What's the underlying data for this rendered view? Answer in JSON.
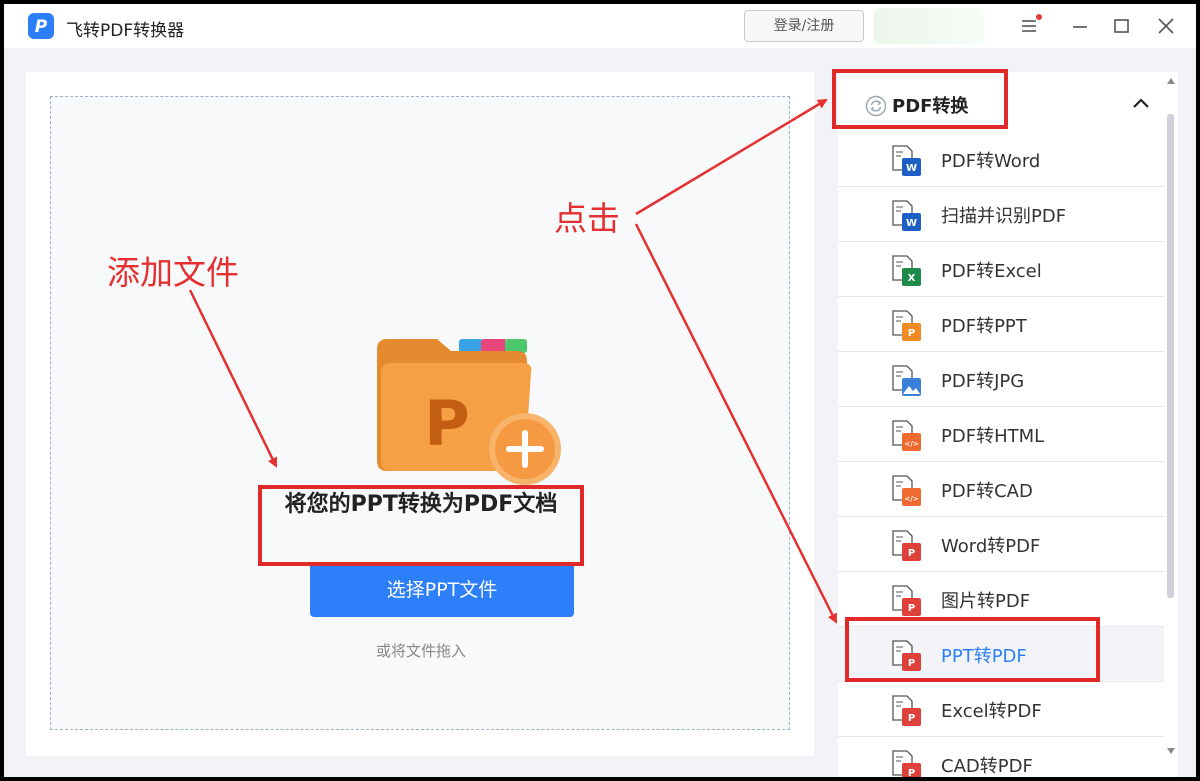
{
  "app": {
    "title": "飞转PDF转换器",
    "login_label": "登录/注册"
  },
  "main": {
    "drop_title": "将您的PPT转换为PDF文档",
    "select_button": "选择PPT文件",
    "drag_hint": "或将文件拖入",
    "folder_letter": "P"
  },
  "sidebar": {
    "section_title": "PDF转换",
    "items": [
      {
        "label": "PDF转Word",
        "icon": "word-icon",
        "badge": "W",
        "badge_color": "#1d5fc4"
      },
      {
        "label": "扫描并识别PDF",
        "icon": "word-icon",
        "badge": "W",
        "badge_color": "#1d5fc4"
      },
      {
        "label": "PDF转Excel",
        "icon": "excel-icon",
        "badge": "X",
        "badge_color": "#1e8a4a"
      },
      {
        "label": "PDF转PPT",
        "icon": "ppt-icon",
        "badge": "P",
        "badge_color": "#f08a24"
      },
      {
        "label": "PDF转JPG",
        "icon": "image-icon",
        "badge": "",
        "badge_color": "#3a7fd8"
      },
      {
        "label": "PDF转HTML",
        "icon": "code-icon",
        "badge": "</>",
        "badge_color": "#ef6a2f"
      },
      {
        "label": "PDF转CAD",
        "icon": "code-icon",
        "badge": "</>",
        "badge_color": "#ef6a2f"
      },
      {
        "label": "Word转PDF",
        "icon": "pdf-icon",
        "badge": "P",
        "badge_color": "#e0403a"
      },
      {
        "label": "图片转PDF",
        "icon": "pdf-icon",
        "badge": "P",
        "badge_color": "#e0403a"
      },
      {
        "label": "PPT转PDF",
        "icon": "pdf-icon",
        "badge": "P",
        "badge_color": "#e0403a",
        "active": true
      },
      {
        "label": "Excel转PDF",
        "icon": "pdf-icon",
        "badge": "P",
        "badge_color": "#e0403a"
      },
      {
        "label": "CAD转PDF",
        "icon": "pdf-icon",
        "badge": "P",
        "badge_color": "#e0403a"
      }
    ]
  },
  "annotations": {
    "add_file": "添加文件",
    "click": "点击"
  },
  "colors": {
    "accent": "#2d7ff9",
    "annotation_red": "#e02a2a",
    "folder_orange": "#f39a3a"
  }
}
